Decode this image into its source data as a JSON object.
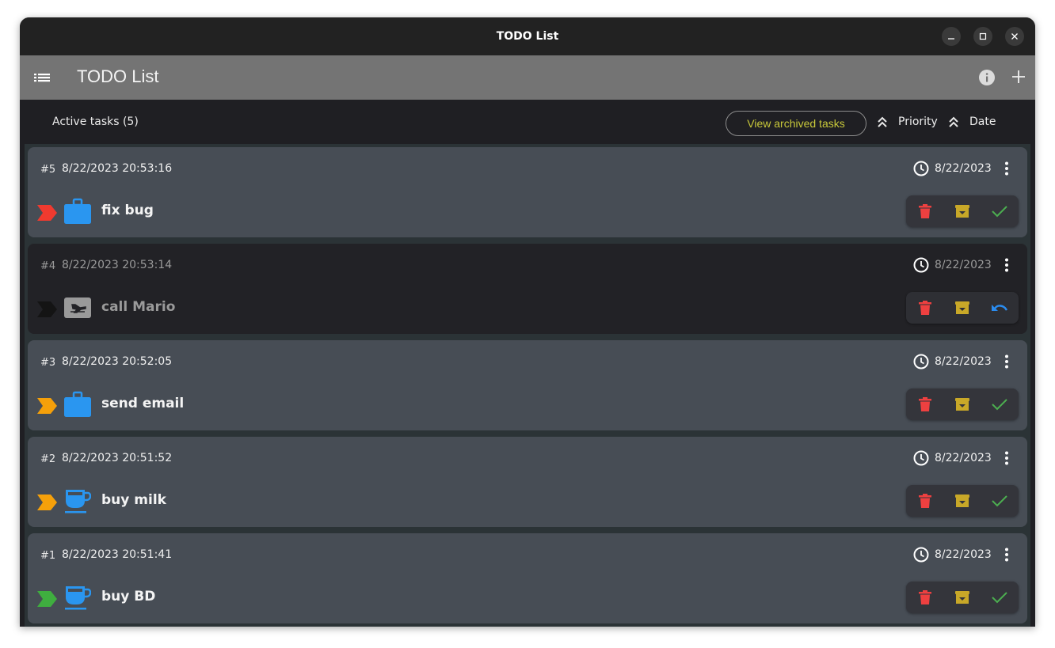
{
  "window": {
    "title": "TODO List"
  },
  "appbar": {
    "title": "TODO List"
  },
  "filter": {
    "active_label": "Active tasks (5)",
    "archived_button": "View archived tasks",
    "sort_priority": "Priority",
    "sort_date": "Date"
  },
  "colors": {
    "priority_high": "#f03a2f",
    "priority_medium": "#f5a00a",
    "priority_low": "#3fae3f",
    "priority_done": "#141414",
    "category": "#2a96f0",
    "delete": "#ee4040",
    "archive": "#c8a828",
    "complete": "#4caf50",
    "undo": "#2a8cf0",
    "archived_button_text": "#c8c83a"
  },
  "tasks": [
    {
      "number": "#5",
      "created": "8/22/2023 20:53:16",
      "due": "8/22/2023",
      "name": "fix bug",
      "priority": "high",
      "category_icon": "briefcase-icon",
      "completed": false
    },
    {
      "number": "#4",
      "created": "8/22/2023 20:53:14",
      "due": "8/22/2023",
      "name": "call Mario",
      "priority": "done",
      "category_icon": "plane-ticket-icon",
      "completed": true
    },
    {
      "number": "#3",
      "created": "8/22/2023 20:52:05",
      "due": "8/22/2023",
      "name": "send email",
      "priority": "medium",
      "category_icon": "briefcase-icon",
      "completed": false
    },
    {
      "number": "#2",
      "created": "8/22/2023 20:51:52",
      "due": "8/22/2023",
      "name": "buy milk",
      "priority": "medium",
      "category_icon": "cup-icon",
      "completed": false
    },
    {
      "number": "#1",
      "created": "8/22/2023 20:51:41",
      "due": "8/22/2023",
      "name": "buy BD",
      "priority": "low",
      "category_icon": "cup-icon",
      "completed": false
    }
  ]
}
